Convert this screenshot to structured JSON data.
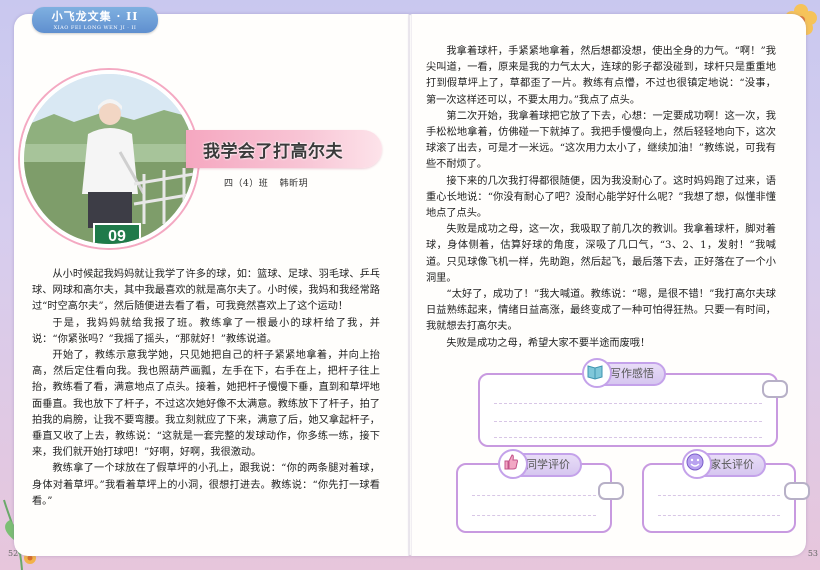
{
  "header": {
    "series_title": "小飞龙文集 · II",
    "series_subtitle": "XIAO FEI LONG WEN JI · II"
  },
  "article": {
    "title": "我学会了打高尔夫",
    "class_name": "四（4）班",
    "author": "韩昕玥"
  },
  "photo": {
    "sign_text": "09"
  },
  "left_paragraphs": [
    "从小时候起我妈妈就让我学了许多的球，如：篮球、足球、羽毛球、乒乓球、网球和高尔夫，其中我最喜欢的就是高尔夫了。小时候，我妈和我经常路过“时空高尔夫”，然后随便进去看了看，可我竟然喜欢上了这个运动！",
    "于是，我妈妈就给我报了班。教练拿了一根最小的球杆给了我，并说：“你紧张吗？”我摇了摇头，“那就好！”教练说道。",
    "开始了，教练示意我学她，只见她把自己的杆子紧紧地拿着，并向上抬高，然后定住看向我。我也照葫芦画瓢，左手在下，右手在上，把杆子往上抬，教练看了看，满意地点了点头。接着，她把杆子慢慢下垂，直到和草坪地面垂直。我也放下了杆子，不过这次她好像不太满意。教练放下了杆子，拍了拍我的肩膀，让我不要弯腰。我立刻就应了下来，满意了后，她又拿起杆子，垂直又收了上去，教练说：“这就是一套完整的发球动作，你多练一练，接下来，我们就开始打球吧！”好啊，好啊，我很激动。",
    "教练拿了一个球放在了假草坪的小孔上，跟我说：“你的两条腿对着球，身体对着草坪。”我看着草坪上的小洞，很想打进去。教练说：“你先打一球看看。”"
  ],
  "right_paragraphs": [
    "我拿着球杆，手紧紧地拿着，然后想都没想，使出全身的力气。“啊！”我尖叫道，一看，原来是我的力气太大，连球的影子都没碰到，球杆只是重重地打到假草坪上了，草都歪了一片。教练有点懵，不过也很镇定地说：“没事，第一次这样还可以，不要太用力。”我点了点头。",
    "第二次开始，我拿着球把它放了下去，心想：一定要成功啊！这一次，我手松松地拿着，仿佛碰一下就掉了。我把手慢慢向上，然后轻轻地向下，这次球滚了出去，可是才一米远。“这次用力太小了，继续加油！”教练说，可我有些不耐烦了。",
    "接下来的几次我打得都很随便，因为我没耐心了。这时妈妈跑了过来，语重心长地说：“你没有耐心了吧？没耐心能学好什么呢？”我想了想，似懂非懂地点了点头。",
    "失败是成功之母，这一次，我吸取了前几次的教训。我拿着球杆，脚对着球，身体侧着，估算好球的角度，深吸了几口气，“3、2、1，发射！”我喊道。只见球像飞机一样，先助跑，然后起飞，最后落下去，正好落在了一个小洞里。",
    "“太好了，成功了！”我大喊道。教练说：“嗯，是很不错！”我打高尔夫球日益熟练起来，情绪日益高涨，最终变成了一种可怕得狂热。只要一有时间，我就想去打高尔夫。",
    "失败是成功之母，希望大家不要半途而废哦！"
  ],
  "cards": {
    "reflection_label": "写作感悟",
    "peer_label": "同学评价",
    "parent_label": "家长评价"
  },
  "page_numbers": {
    "left": "52",
    "right": "53"
  },
  "colors": {
    "accent_pink": "#f5a7c0",
    "card_border": "#c89ae0",
    "tab_blue": "#5f8fcf"
  },
  "icons": [
    "book-icon",
    "thumbs-up-icon",
    "smiley-icon",
    "flower-icon",
    "leaf-icon"
  ]
}
